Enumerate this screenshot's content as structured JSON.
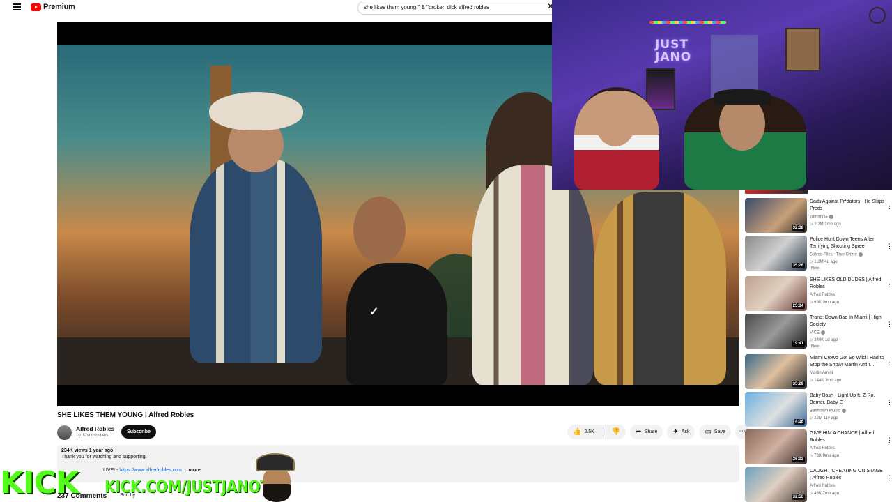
{
  "header": {
    "logo_text": "Premium",
    "search_value": "she likes them young \" & \"broken dick  alfred robles",
    "search_clear": "✕"
  },
  "video": {
    "title": "SHE LIKES THEM YOUNG | Alfred Robles",
    "channel": "Alfred Robles",
    "subscribers": "101K subscribers",
    "subscribe_label": "Subscribe",
    "likes": "2.5K",
    "share_label": "Share",
    "ask_label": "Ask",
    "save_label": "Save",
    "views_date": "234K views  1 year ago",
    "description_line": "Thank you for watching and supporting!",
    "description_link_prefix": "LIVE! - ",
    "description_link": "https://www.alfredrobles.com",
    "description_more": "...more",
    "comments_label": "237 Comments",
    "sort_label": "Sort by"
  },
  "overlay": {
    "kick_logo": "KICK",
    "kick_url": "KICK.COM/JUSTJANOTV",
    "webcam_sign": "JUST\nJANO"
  },
  "recommendations": [
    {
      "title": "Dads Against Pr*dators - He Slaps Preds",
      "channel": "Tommy G",
      "verified": true,
      "meta": "▷ 2.2M  1mo ago",
      "new": "",
      "duration": "32:38",
      "thumb": "linear-gradient(135deg,#3a4a6a,#c9a07a 60%,#2a2a2a)"
    },
    {
      "title": "Police Hunt Down Teens After Terrifying Shooting Spree",
      "channel": "Solved Files - True Crime",
      "verified": true,
      "meta": "▷ 1.2M  4d ago",
      "new": "New",
      "duration": "35:26",
      "thumb": "linear-gradient(135deg,#8a8a8a,#d0d0d0 50%,#2a3a4a)"
    },
    {
      "title": "SHE LIKES OLD DUDES | Alfred Robles",
      "channel": "Alfred Robles",
      "verified": false,
      "meta": "▷ 69K  9mo ago",
      "new": "",
      "duration": "25:34",
      "thumb": "linear-gradient(135deg,#c0a090,#e0d0c0 50%,#6a3a3a)"
    },
    {
      "title": "Tranq: Down Bad In Miami | High Society",
      "channel": "VICE",
      "verified": true,
      "meta": "▷ 340K  1d ago",
      "new": "New",
      "duration": "19:41",
      "thumb": "linear-gradient(135deg,#4a4a4a,#9a9a9a 50%,#1a1a1a)"
    },
    {
      "title": "Miami Crowd Got So Wild I Had to Stop the Show! Martin Amin...",
      "channel": "Martin Amini",
      "verified": false,
      "meta": "▷ 144K  3mo ago",
      "new": "",
      "duration": "35:29",
      "thumb": "linear-gradient(135deg,#3a6a8a,#e0c0a0 50%,#2a2a2a)"
    },
    {
      "title": "Baby Bash - Light Up ft. Z-Ro, Berner, Baby-E",
      "channel": "Bashtown Music",
      "verified": true,
      "meta": "▷ 22M  11y ago",
      "new": "",
      "duration": "4:16",
      "thumb": "linear-gradient(135deg,#6ab0e0,#e0e0e0 55%,#3a6a9a)"
    },
    {
      "title": "GIVE HIM A CHANCE | Alfred Robles",
      "channel": "Alfred Robles",
      "verified": false,
      "meta": "▷ 73K  9mo ago",
      "new": "",
      "duration": "26:33",
      "thumb": "linear-gradient(135deg,#8a6a5a,#d0b0a0 50%,#3a2a2a)"
    },
    {
      "title": "CAUGHT CHEATING ON STAGE | Alfred Robles",
      "channel": "Alfred Robles",
      "verified": false,
      "meta": "▷ 48K  7mo ago",
      "new": "",
      "duration": "32:56",
      "thumb": "linear-gradient(135deg,#6aa0c0,#e0d0c0 50%,#4a3a3a)"
    }
  ],
  "icons": {
    "like": "👍",
    "dislike": "👎",
    "share": "➦",
    "ask": "✦",
    "save": "▭",
    "more": "⋯",
    "menu": "⋮"
  }
}
